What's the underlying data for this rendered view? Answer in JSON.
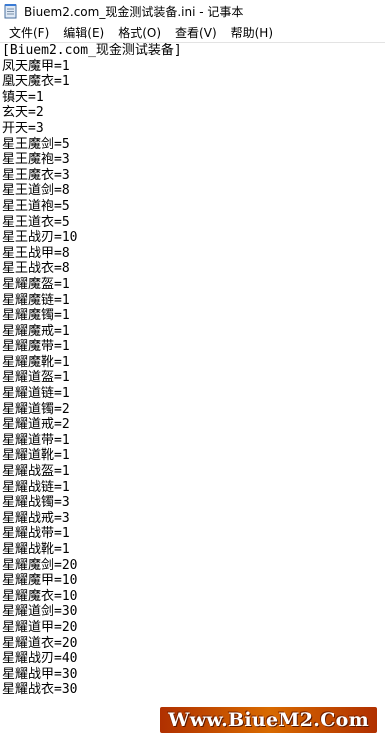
{
  "window": {
    "title": "Biuem2.com_现金测试装备.ini - 记事本",
    "icon": "notepad-icon"
  },
  "menubar": {
    "items": [
      {
        "label": "文件(F)"
      },
      {
        "label": "编辑(E)"
      },
      {
        "label": "格式(O)"
      },
      {
        "label": "查看(V)"
      },
      {
        "label": "帮助(H)"
      }
    ]
  },
  "editor": {
    "lines": [
      "[Biuem2.com_现金测试装备]",
      "凤天魔甲=1",
      "凰天魔衣=1",
      "镇天=1",
      "玄天=2",
      "开天=3",
      "星王魔剑=5",
      "星王魔袍=3",
      "星王魔衣=3",
      "星王道剑=8",
      "星王道袍=5",
      "星王道衣=5",
      "星王战刃=10",
      "星王战甲=8",
      "星王战衣=8",
      "星耀魔盔=1",
      "星耀魔链=1",
      "星耀魔镯=1",
      "星耀魔戒=1",
      "星耀魔带=1",
      "星耀魔靴=1",
      "星耀道盔=1",
      "星耀道链=1",
      "星耀道镯=2",
      "星耀道戒=2",
      "星耀道带=1",
      "星耀道靴=1",
      "星耀战盔=1",
      "星耀战链=1",
      "星耀战镯=3",
      "星耀战戒=3",
      "星耀战带=1",
      "星耀战靴=1",
      "星耀魔剑=20",
      "星耀魔甲=10",
      "星耀魔衣=10",
      "星耀道剑=30",
      "星耀道甲=20",
      "星耀道衣=20",
      "星耀战刃=40",
      "星耀战甲=30",
      "星耀战衣=30"
    ]
  },
  "watermark": {
    "text": "Www.BiueM2.Com"
  }
}
